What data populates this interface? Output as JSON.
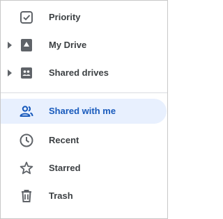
{
  "nav": {
    "items": [
      {
        "label": "Priority",
        "icon": "priority-check-icon"
      },
      {
        "label": "My Drive",
        "icon": "my-drive-icon",
        "expandable": true
      },
      {
        "label": "Shared drives",
        "icon": "shared-drives-icon",
        "expandable": true
      },
      {
        "label": "Shared with me",
        "icon": "shared-with-me-icon",
        "selected": true
      },
      {
        "label": "Recent",
        "icon": "clock-icon"
      },
      {
        "label": "Starred",
        "icon": "star-icon"
      },
      {
        "label": "Trash",
        "icon": "trash-icon"
      }
    ]
  },
  "colors": {
    "active_bg": "#e8f0fe",
    "active_text": "#185abc",
    "text": "#3c4043",
    "icon": "#5f6368",
    "divider": "#dadce0"
  }
}
